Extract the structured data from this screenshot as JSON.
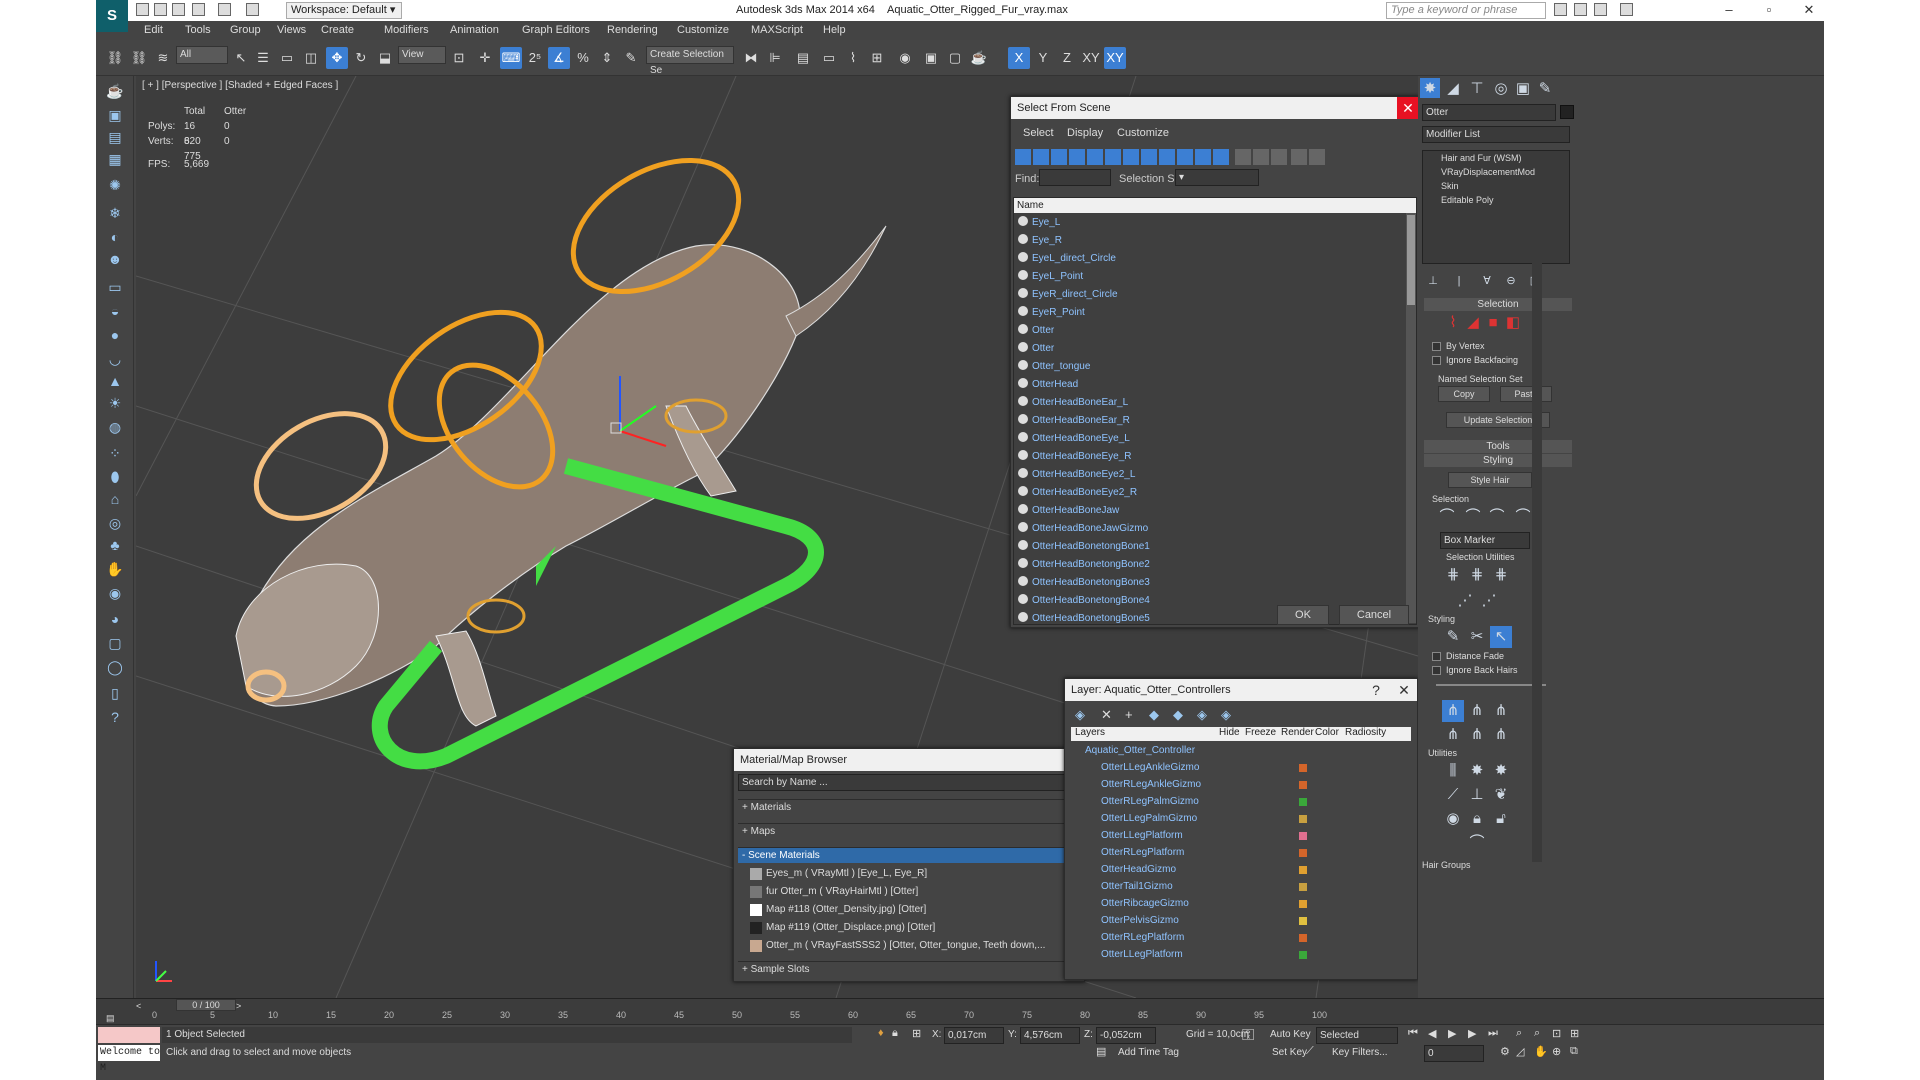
{
  "title": {
    "app": "Autodesk 3ds Max  2014 x64",
    "file": "Aquatic_Otter_Rigged_Fur_vray.max",
    "workspace": "Workspace: Default",
    "search_placeholder": "Type a keyword or phrase"
  },
  "menu": [
    "Edit",
    "Tools",
    "Group",
    "Views",
    "Create",
    "Modifiers",
    "Animation",
    "Graph Editors",
    "Rendering",
    "Customize",
    "MAXScript",
    "Help"
  ],
  "toolbar": {
    "filter": "All",
    "ref_coord": "View",
    "selection_set": "Create Selection Se",
    "axes": [
      "X",
      "Y",
      "Z",
      "XY",
      "XY"
    ]
  },
  "viewport": {
    "label": "[ + ] [Perspective ] [Shaded + Edged Faces ]",
    "stats_header": [
      "Total",
      "Otter"
    ],
    "polys_label": "Polys:",
    "polys_total": "16 620",
    "polys_sel": "0",
    "verts_label": "Verts:",
    "verts_total": "8 775",
    "verts_sel": "0",
    "fps_label": "FPS:",
    "fps": "5,669"
  },
  "select_from_scene": {
    "title": "Select From Scene",
    "menu": [
      "Select",
      "Display",
      "Customize"
    ],
    "find_label": "Find:",
    "selection_set_label": "Selection Set:",
    "column": "Name",
    "items": [
      "Eye_L",
      "Eye_R",
      "EyeL_direct_Circle",
      "EyeL_Point",
      "EyeR_direct_Circle",
      "EyeR_Point",
      "Otter",
      "Otter",
      "Otter_tongue",
      "OtterHead",
      "OtterHeadBoneEar_L",
      "OtterHeadBoneEar_R",
      "OtterHeadBoneEye_L",
      "OtterHeadBoneEye_R",
      "OtterHeadBoneEye2_L",
      "OtterHeadBoneEye2_R",
      "OtterHeadBoneJaw",
      "OtterHeadBoneJawGizmo",
      "OtterHeadBonetongBone1",
      "OtterHeadBonetongBone2",
      "OtterHeadBonetongBone3",
      "OtterHeadBonetongBone4",
      "OtterHeadBonetongBone5"
    ],
    "ok": "OK",
    "cancel": "Cancel"
  },
  "material_browser": {
    "title": "Material/Map Browser",
    "search_placeholder": "Search by Name ...",
    "categories": {
      "materials": "+ Materials",
      "maps": "+ Maps",
      "scene": "- Scene Materials",
      "samples": "+ Sample Slots"
    },
    "scene_items": [
      "Eyes_m  ( VRayMtl ) [Eye_L, Eye_R]",
      "fur Otter_m  ( VRayHairMtl ) [Otter]",
      "Map #118 (Otter_Density.jpg) [Otter]",
      "Map #119 (Otter_Displace.png) [Otter]",
      "Otter_m  ( VRayFastSSS2 ) [Otter, Otter_tongue, Teeth down,..."
    ]
  },
  "layer_dialog": {
    "title": "Layer: Aquatic_Otter_Controllers",
    "help": "?",
    "columns": [
      "Layers",
      "Hide",
      "Freeze",
      "Render",
      "Color",
      "Radiosity"
    ],
    "root": "Aquatic_Otter_Controller",
    "items": [
      "OtterLLegAnkleGizmo",
      "OtterRLegAnkleGizmo",
      "OtterRLegPalmGizmo",
      "OtterLLegPalmGizmo",
      "OtterLLegPlatform",
      "OtterRLegPlatform",
      "OtterHeadGizmo",
      "OtterTail1Gizmo",
      "OtterRibcageGizmo",
      "OtterPelvisGizmo",
      "OtterRLegPlatform",
      "OtterLLegPlatform"
    ],
    "colors": [
      "#d4652a",
      "#d4652a",
      "#3aa83a",
      "#c8a040",
      "#e07090",
      "#d4652a",
      "#e0a030",
      "#c8a040",
      "#e0a030",
      "#e0c040",
      "#d4652a",
      "#3aa83a"
    ]
  },
  "command_panel": {
    "object_name": "Otter",
    "modifier_list": "Modifier List",
    "stack": [
      "Hair and Fur (WSM)",
      "VRayDisplacementMod",
      "Skin",
      "Editable Poly"
    ],
    "selection_title": "Selection",
    "by_vertex": "By Vertex",
    "ignore_backfacing": "Ignore Backfacing",
    "named_selection_sets": "Named Selection Set",
    "copy": "Copy",
    "paste": "Paste",
    "update_selection": "Update Selection",
    "tools_title": "Tools",
    "styling_title": "Styling",
    "style_hair": "Style Hair",
    "sub_selection": "Selection",
    "box_marker": "Box Marker",
    "selection_utilities": "Selection Utilities",
    "sub_styling": "Styling",
    "distance_fade": "Distance Fade",
    "ignore_back_hairs": "Ignore Back Hairs",
    "utilities": "Utilities",
    "hair_groups": "Hair Groups"
  },
  "timeline": {
    "frame": "0 / 100",
    "ticks": [
      "0",
      "5",
      "10",
      "15",
      "20",
      "25",
      "30",
      "35",
      "40",
      "45",
      "50",
      "55",
      "60",
      "65",
      "70",
      "75",
      "80",
      "85",
      "90",
      "95",
      "100"
    ]
  },
  "status": {
    "welcome": "Welcome to M",
    "selected": "1 Object Selected",
    "hint": "Click and drag to select and move objects",
    "x_label": "X:",
    "x": "0,017cm",
    "y_label": "Y:",
    "y": "4,576cm",
    "z_label": "Z:",
    "z": "-0,052cm",
    "grid": "Grid = 10,0cm",
    "auto_key": "Auto Key",
    "selected_dd": "Selected",
    "set_key": "Set Key",
    "key_filters": "Key Filters...",
    "add_time_tag": "Add Time Tag",
    "frame_field": "0"
  },
  "colors": {
    "accent": "#3c7fd3",
    "viewport_bg": "#3d3d3d",
    "green_gizmo": "#44dd44",
    "orange_gizmo": "#f0a020"
  }
}
